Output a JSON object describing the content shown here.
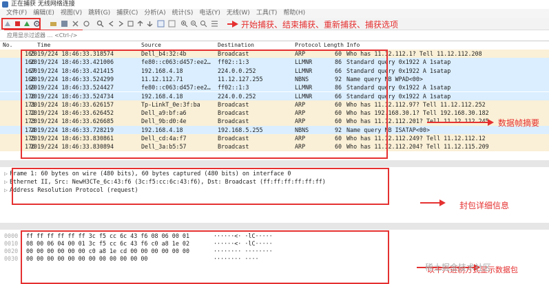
{
  "window": {
    "title": "正在捕获 无线网络连接"
  },
  "menu": [
    "文件(F)",
    "编辑(E)",
    "视图(V)",
    "跳转(G)",
    "捕获(C)",
    "分析(A)",
    "统计(S)",
    "电话(Y)",
    "无线(W)",
    "工具(T)",
    "帮助(H)"
  ],
  "toolbar": {
    "icons": [
      "shark-fin-icon",
      "stop-icon",
      "restart-icon",
      "options-gear-icon"
    ]
  },
  "filter": {
    "placeholder": "应用显示过滤器 … <Ctrl-/>"
  },
  "columns": {
    "no": "No.",
    "time": "Time",
    "source": "Source",
    "destination": "Destination",
    "protocol": "Protocol",
    "length": "Length",
    "info": "Info"
  },
  "packets": [
    {
      "no": "165",
      "time": "2019/224 18:46:33.318574",
      "src": "Dell_b4:32:4b",
      "dst": "Broadcast",
      "proto": "ARP",
      "len": "60",
      "info": "Who has 11.12.112.1? Tell 11.12.112.208",
      "kind": "arp"
    },
    {
      "no": "166",
      "time": "2019/224 18:46:33.421006",
      "src": "fe80::c063:d457:ee2…",
      "dst": "ff02::1:3",
      "proto": "LLMNR",
      "len": "86",
      "info": "Standard query 0x1922 A 1satap",
      "kind": "udp"
    },
    {
      "no": "167",
      "time": "2019/224 18:46:33.421415",
      "src": "192.168.4.18",
      "dst": "224.0.0.252",
      "proto": "LLMNR",
      "len": "66",
      "info": "Standard query 0x1922 A 1satap",
      "kind": "udp"
    },
    {
      "no": "168",
      "time": "2019/224 18:46:33.524299",
      "src": "11.12.112.71",
      "dst": "11.12.127.255",
      "proto": "NBNS",
      "len": "92",
      "info": "Name query NB WPAD<00>",
      "kind": "nbns"
    },
    {
      "no": "169",
      "time": "2019/224 18:46:33.524427",
      "src": "fe80::c063:d457:ee2…",
      "dst": "ff02::1:3",
      "proto": "LLMNR",
      "len": "86",
      "info": "Standard query 0x1922 A 1satap",
      "kind": "udp"
    },
    {
      "no": "170",
      "time": "2019/224 18:46:33.524734",
      "src": "192.168.4.18",
      "dst": "224.0.0.252",
      "proto": "LLMNR",
      "len": "66",
      "info": "Standard query 0x1922 A 1satap",
      "kind": "udp"
    },
    {
      "no": "171",
      "time": "2019/224 18:46:33.626157",
      "src": "Tp-LinkT_0e:3f:ba",
      "dst": "Broadcast",
      "proto": "ARP",
      "len": "60",
      "info": "Who has 11.12.112.97? Tell 11.12.112.252",
      "kind": "arp"
    },
    {
      "no": "172",
      "time": "2019/224 18:46:33.626452",
      "src": "Dell_a9:bf:a6",
      "dst": "Broadcast",
      "proto": "ARP",
      "len": "60",
      "info": "Who has 192.168.30.1? Tell 192.168.30.182",
      "kind": "arp"
    },
    {
      "no": "173",
      "time": "2019/224 18:46:33.626685",
      "src": "Dell_9b:d0:4e",
      "dst": "Broadcast",
      "proto": "ARP",
      "len": "60",
      "info": "Who has 11.12.112.201? Tell 11.12.112.245",
      "kind": "arp"
    },
    {
      "no": "174",
      "time": "2019/224 18:46:33.728219",
      "src": "192.168.4.18",
      "dst": "192.168.5.255",
      "proto": "NBNS",
      "len": "92",
      "info": "Name query NB ISATAP<00>",
      "kind": "nbns"
    },
    {
      "no": "175",
      "time": "2019/224 18:46:33.830861",
      "src": "Dell_cd:4a:f7",
      "dst": "Broadcast",
      "proto": "ARP",
      "len": "60",
      "info": "Who has 11.12.112.249? Tell 11.12.112.12",
      "kind": "arp"
    },
    {
      "no": "176",
      "time": "2019/224 18:46:33.830894",
      "src": "Dell_3a:b5:57",
      "dst": "Broadcast",
      "proto": "ARP",
      "len": "60",
      "info": "Who has 11.12.112.204? Tell 11.12.115.209",
      "kind": "arp"
    }
  ],
  "details": [
    "Frame 1: 60 bytes on wire (480 bits), 60 bytes captured (480 bits) on interface 0",
    "Ethernet II, Src: NewH3CTe_6c:43:f6 (3c:f5:cc:6c:43:f6), Dst: Broadcast (ff:ff:ff:ff:ff:ff)",
    "Address Resolution Protocol (request)"
  ],
  "hex": [
    {
      "offset": "0000",
      "bytes": "ff ff ff ff ff ff 3c f5  cc 6c 43 f6 08 06 00 01",
      "ascii": "······<· ·lC·····"
    },
    {
      "offset": "0010",
      "bytes": "08 00 06 04 00 01 3c f5  cc 6c 43 f6 c0 a8 1e 02",
      "ascii": "······<· ·lC·····"
    },
    {
      "offset": "0020",
      "bytes": "00 00 00 00 00 00 c0 a8  1e cd 00 00 00 00 00 00",
      "ascii": "········ ········"
    },
    {
      "offset": "0030",
      "bytes": "00 00 00 00 00 00 00 00  00 00 00 00",
      "ascii": "········ ····"
    }
  ],
  "annotations": {
    "toolbar_note": "开始捕获、结束捕获、重新捕获、捕获选项",
    "summary_note": "数据帧摘要",
    "details_note": "封包详细信息",
    "hex_note": "以十六进制方式显示数据包"
  },
  "watermark": "稀土掘金技术社区",
  "colors": {
    "annotation": "#e53030",
    "arp_row": "#faf0d7",
    "udp_row": "#daeeff"
  }
}
